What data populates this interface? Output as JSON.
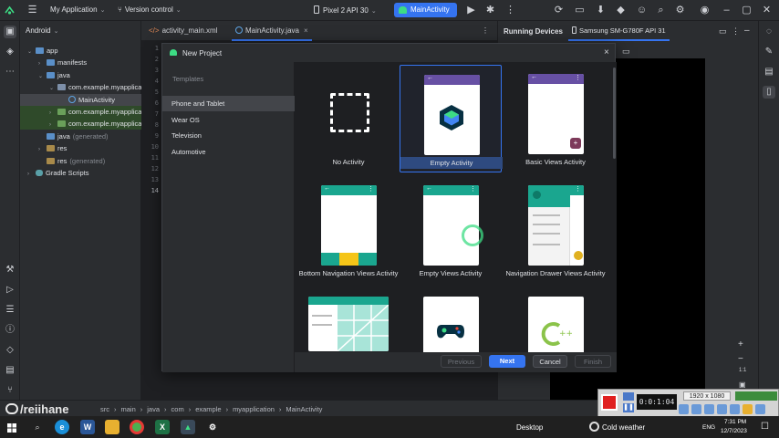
{
  "titlebar": {
    "app_name": "My Application",
    "vcs": "Version control",
    "device_config": "Pixel 2 API 30",
    "run_config": "MainActivity"
  },
  "project_panel": {
    "view_mode": "Android",
    "tree": [
      {
        "label": "app",
        "indent": 0,
        "arrow": "open",
        "kind": "folder"
      },
      {
        "label": "manifests",
        "indent": 1,
        "arrow": "closed",
        "kind": "folder"
      },
      {
        "label": "java",
        "indent": 1,
        "arrow": "open",
        "kind": "folder"
      },
      {
        "label": "com.example.myapplica",
        "indent": 2,
        "arrow": "open",
        "kind": "package"
      },
      {
        "label": "MainActivity",
        "indent": 3,
        "arrow": "none",
        "kind": "class",
        "selected": true
      },
      {
        "label": "com.example.myapplica",
        "indent": 2,
        "arrow": "closed",
        "kind": "package",
        "test": true
      },
      {
        "label": "com.example.myapplica",
        "indent": 2,
        "arrow": "closed",
        "kind": "package",
        "test": true
      },
      {
        "label": "java",
        "suffix": "(generated)",
        "indent": 1,
        "arrow": "none",
        "kind": "folder"
      },
      {
        "label": "res",
        "indent": 1,
        "arrow": "closed",
        "kind": "res"
      },
      {
        "label": "res",
        "suffix": "(generated)",
        "indent": 1,
        "arrow": "none",
        "kind": "res"
      },
      {
        "label": "Gradle Scripts",
        "indent": 0,
        "arrow": "closed",
        "kind": "gradle"
      }
    ]
  },
  "editor": {
    "tabs": [
      {
        "label": "activity_main.xml",
        "active": false
      },
      {
        "label": "MainActivity.java",
        "active": true
      }
    ],
    "line_numbers": [
      "1",
      "2",
      "3",
      "4",
      "5",
      "6",
      "7",
      "8",
      "9",
      "10",
      "11",
      "12",
      "13",
      "14"
    ]
  },
  "running_devices": {
    "title": "Running Devices",
    "device_tab": "Samsung SM-G780F API 31"
  },
  "dialog": {
    "title": "New Project",
    "section_label": "Templates",
    "categories": [
      {
        "label": "Phone and Tablet",
        "selected": true
      },
      {
        "label": "Wear OS",
        "selected": false
      },
      {
        "label": "Television",
        "selected": false
      },
      {
        "label": "Automotive",
        "selected": false
      }
    ],
    "templates": [
      {
        "label": "No Activity",
        "selected": false
      },
      {
        "label": "Empty Activity",
        "selected": true
      },
      {
        "label": "Basic Views Activity",
        "selected": false
      },
      {
        "label": "Bottom Navigation Views Activity",
        "selected": false
      },
      {
        "label": "Empty Views Activity",
        "selected": false
      },
      {
        "label": "Navigation Drawer Views Activity",
        "selected": false
      },
      {
        "label": "",
        "selected": false
      },
      {
        "label": "",
        "selected": false
      },
      {
        "label": "",
        "selected": false
      }
    ],
    "buttons": {
      "previous": "Previous",
      "next": "Next",
      "cancel": "Cancel",
      "finish": "Finish"
    },
    "colors": {
      "compose_purple": "#6750a4",
      "views_teal": "#1aa68f",
      "accent_blue": "#3574f0",
      "fab_purple": "#7d3a5a",
      "bottom_yellow": "#f5c518"
    }
  },
  "statusbar": {
    "breadcrumb": [
      "src",
      "main",
      "java",
      "com",
      "example",
      "myapplication",
      "MainActivity"
    ],
    "watermark": "/reiihane"
  },
  "recorder": {
    "timer": "0:0:1:04",
    "resolution": "1920 x 1080"
  },
  "taskbar": {
    "desktop_label": "Desktop",
    "weather": "Cold weather",
    "language": "ENG",
    "time": "7:31 PM",
    "date": "12/7/2023"
  }
}
